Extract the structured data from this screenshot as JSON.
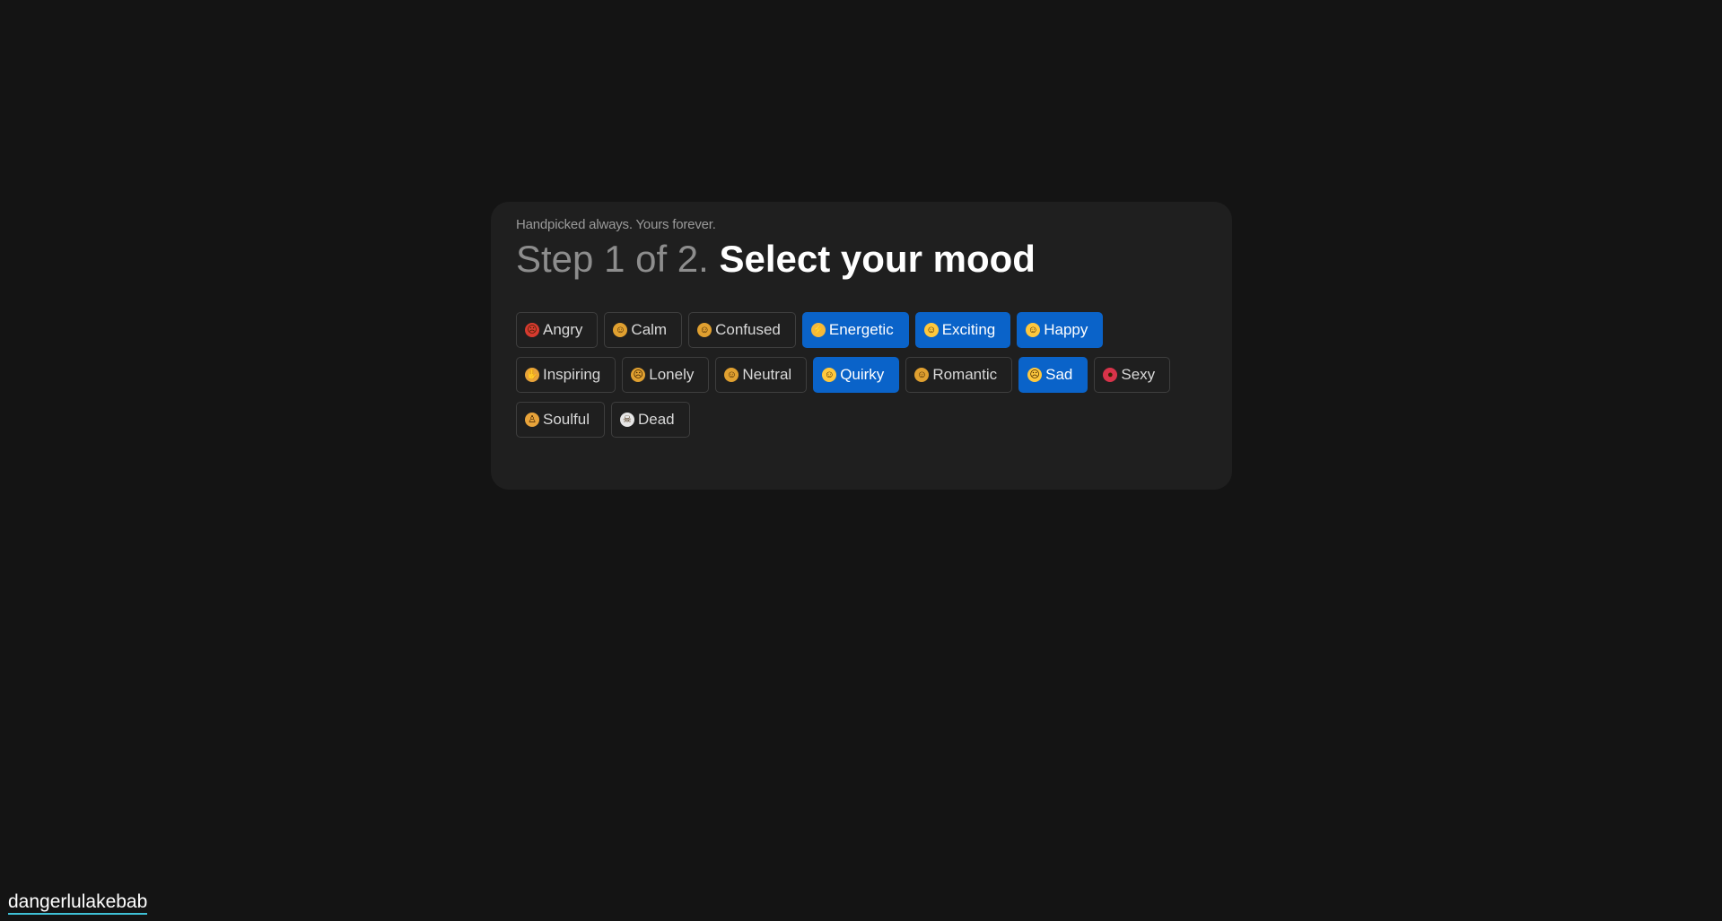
{
  "card": {
    "tagline": "Handpicked always. Yours forever.",
    "step": "Step 1 of 2.",
    "title": "Select your mood"
  },
  "moods": [
    [
      {
        "label": "Angry",
        "icon": "angry-face-icon",
        "color": "#d63a2f",
        "glyph": "☹",
        "selected": false
      },
      {
        "label": "Calm",
        "icon": "calm-face-icon",
        "color": "#e0a030",
        "glyph": "☺",
        "selected": false
      },
      {
        "label": "Confused",
        "icon": "confused-face-icon",
        "color": "#e0a030",
        "glyph": "☺",
        "selected": false
      },
      {
        "label": "Energetic",
        "icon": "lightning-icon",
        "color": "#f6b93b",
        "glyph": "⚡",
        "selected": true
      },
      {
        "label": "Exciting",
        "icon": "tongue-face-icon",
        "color": "#ffc83d",
        "glyph": "☺",
        "selected": true
      },
      {
        "label": "Happy",
        "icon": "grin-face-icon",
        "color": "#ffc83d",
        "glyph": "☺",
        "selected": true
      }
    ],
    [
      {
        "label": "Inspiring",
        "icon": "raised-hands-icon",
        "color": "#e8a33a",
        "glyph": "✋",
        "selected": false
      },
      {
        "label": "Lonely",
        "icon": "lonely-face-icon",
        "color": "#e0a030",
        "glyph": "☹",
        "selected": false
      },
      {
        "label": "Neutral",
        "icon": "neutral-face-icon",
        "color": "#e0a030",
        "glyph": "☺",
        "selected": false
      },
      {
        "label": "Quirky",
        "icon": "zany-face-icon",
        "color": "#ffc83d",
        "glyph": "☺",
        "selected": true
      },
      {
        "label": "Romantic",
        "icon": "romantic-face-icon",
        "color": "#e0a030",
        "glyph": "☺",
        "selected": false
      },
      {
        "label": "Sad",
        "icon": "sad-face-icon",
        "color": "#ffc83d",
        "glyph": "☹",
        "selected": true
      },
      {
        "label": "Sexy",
        "icon": "lips-icon",
        "color": "#d8334a",
        "glyph": "●",
        "selected": false
      }
    ],
    [
      {
        "label": "Soulful",
        "icon": "meditation-icon",
        "color": "#e8a33a",
        "glyph": "♙",
        "selected": false
      },
      {
        "label": "Dead",
        "icon": "skull-icon",
        "color": "#e6e6e6",
        "glyph": "☠",
        "selected": false
      }
    ]
  ],
  "footer": {
    "link_text": "dangerlulakebab"
  }
}
